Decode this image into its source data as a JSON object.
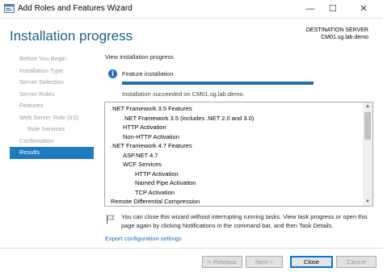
{
  "window": {
    "title": "Add Roles and Features Wizard",
    "minimize_glyph": "—",
    "maximize_glyph": "☐",
    "close_glyph": "✕"
  },
  "page": {
    "heading": "Installation progress",
    "destination_label": "DESTINATION SERVER",
    "destination_server": "CM01.sg.lab.demo"
  },
  "sidebar": {
    "items": [
      {
        "label": "Before You Begin",
        "active": false,
        "sub": false
      },
      {
        "label": "Installation Type",
        "active": false,
        "sub": false
      },
      {
        "label": "Server Selection",
        "active": false,
        "sub": false
      },
      {
        "label": "Server Roles",
        "active": false,
        "sub": false
      },
      {
        "label": "Features",
        "active": false,
        "sub": false
      },
      {
        "label": "Web Server Role (IIS)",
        "active": false,
        "sub": false
      },
      {
        "label": "Role Services",
        "active": false,
        "sub": true
      },
      {
        "label": "Confirmation",
        "active": false,
        "sub": false
      },
      {
        "label": "Results",
        "active": true,
        "sub": false
      }
    ]
  },
  "main": {
    "view_label": "View installation progress",
    "feature_label": "Feature installation",
    "progress_fraction": 1.0,
    "succeeded_text": "Installation succeeded on CM01.sg.lab.demo.",
    "results": [
      {
        "text": ".NET Framework 3.5 Features",
        "level": 0
      },
      {
        "text": ".NET Framework 3.5 (includes .NET 2.0 and 3.0)",
        "level": 1
      },
      {
        "text": "HTTP Activation",
        "level": 1
      },
      {
        "text": "Non-HTTP Activation",
        "level": 1
      },
      {
        "text": ".NET Framework 4.7 Features",
        "level": 0
      },
      {
        "text": "ASP.NET 4.7",
        "level": 1
      },
      {
        "text": "WCF Services",
        "level": 1
      },
      {
        "text": "HTTP Activation",
        "level": 2
      },
      {
        "text": "Named Pipe Activation",
        "level": 2
      },
      {
        "text": "TCP Activation",
        "level": 2
      },
      {
        "text": "Remote Differential Compression",
        "level": 0
      }
    ],
    "note_text": "You can close this wizard without interrupting running tasks. View task progress or open this page again by clicking Notifications in the command bar, and then Task Details.",
    "export_link": "Export configuration settings"
  },
  "footer": {
    "prev_label": "< Previous",
    "next_label": "Next >",
    "close_label": "Close",
    "cancel_label": "Cancel"
  },
  "icons": {
    "info": "info-icon",
    "note": "flag-icon",
    "app": "wizard-app-icon"
  },
  "colors": {
    "heading": "#1b5f8c",
    "active_nav": "#1f7ac2",
    "progress": "#1f6fa8",
    "link": "#1f6fb5"
  }
}
